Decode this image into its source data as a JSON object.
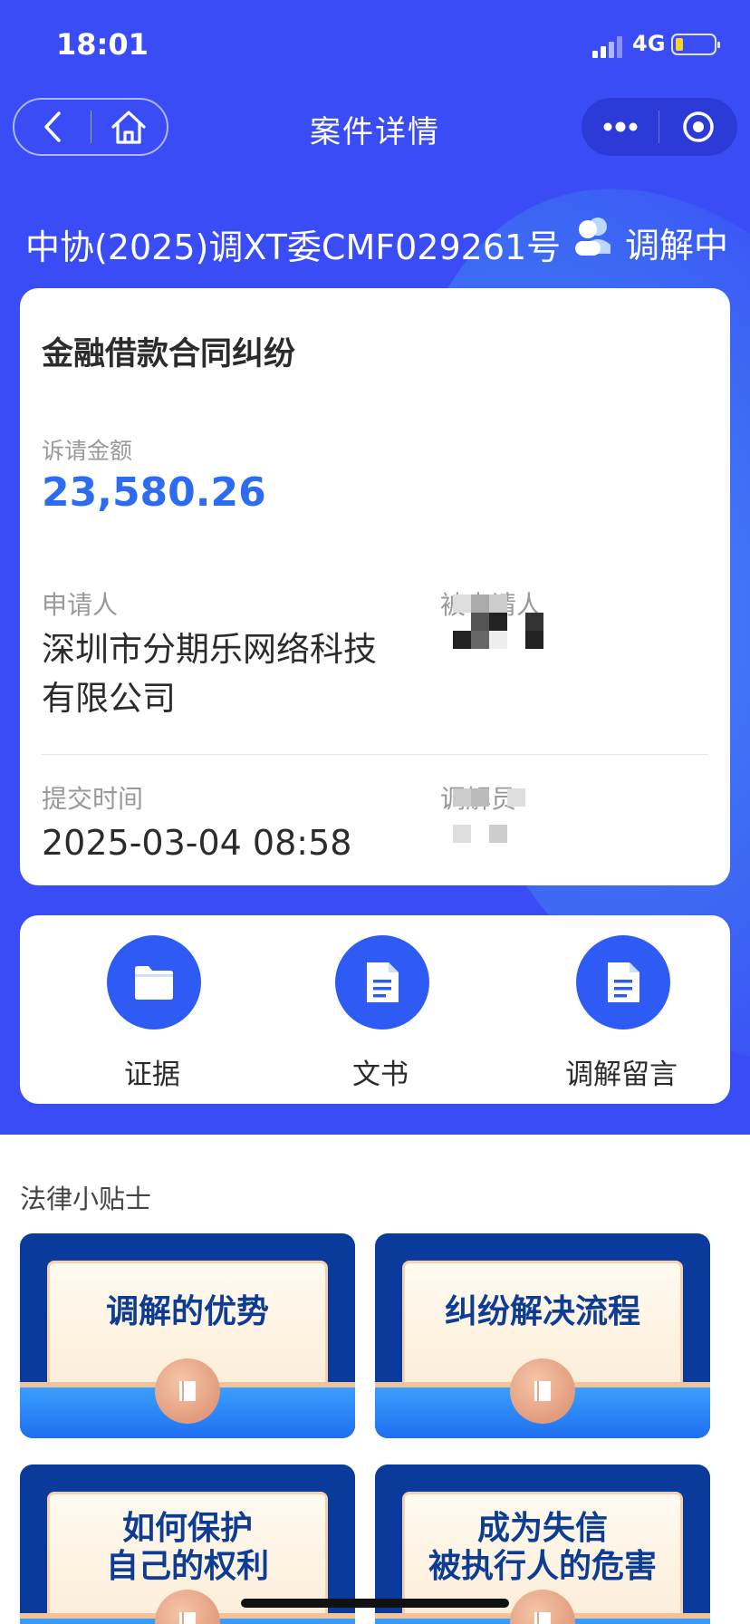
{
  "status_bar": {
    "time": "18:01",
    "network": "4G"
  },
  "nav": {
    "title": "案件详情"
  },
  "case": {
    "number": "中协(2025)调XT委CMF029261号",
    "status": "调解中",
    "dispute_type": "金融借款合同纠纷",
    "claim_label": "诉请金额",
    "claim_amount": "23,580.26",
    "applicant_label": "申请人",
    "applicant_value": "深圳市分期乐网络科技有限公司",
    "respondent_label": "被申请人",
    "submit_label": "提交时间",
    "submit_value": "2025-03-04 08:58",
    "mediator_label": "调解员"
  },
  "actions": [
    {
      "label": "证据",
      "icon": "folder-icon"
    },
    {
      "label": "文书",
      "icon": "document-icon"
    },
    {
      "label": "调解留言",
      "icon": "document-icon"
    }
  ],
  "tips": {
    "title": "法律小贴士",
    "items": [
      {
        "title": "调解的优势"
      },
      {
        "title": "纠纷解决流程"
      },
      {
        "title": "如何保护\n自己的权利"
      },
      {
        "title": "成为失信\n被执行人的危害"
      }
    ]
  },
  "colors": {
    "primary": "#3a4cf6",
    "amount": "#2d6cf0",
    "action": "#2f5bf5"
  }
}
